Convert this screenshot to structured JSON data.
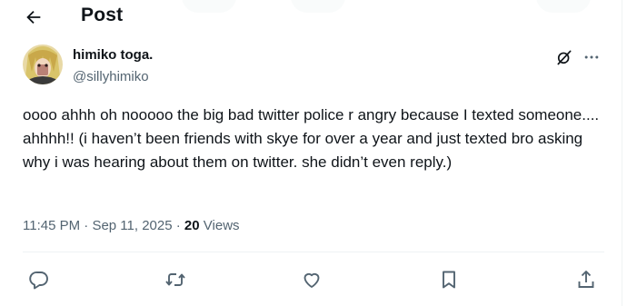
{
  "header": {
    "title": "Post",
    "back_icon": "arrow-left-icon"
  },
  "author": {
    "display_name": "himiko toga.",
    "handle": "@sillyhimiko",
    "avatar_icon": "avatar"
  },
  "tweet": {
    "text": "oooo ahhh oh nooooo the big bad twitter police r angry because I texted someone.... ahhhh!! (i haven’t been friends with skye for over a year and just texted bro asking why i was hearing about them on twitter. she didn’t even reply.)",
    "time": "11:45 PM",
    "date": "Sep 11, 2025",
    "separator": "·",
    "views_count": "20",
    "views_label": "Views"
  },
  "actions": [
    "reply-icon",
    "repost-icon",
    "like-icon",
    "bookmark-icon",
    "share-icon"
  ],
  "colors": {
    "text": "#0f1419",
    "secondary": "#536471",
    "divider": "#eff3f4"
  }
}
